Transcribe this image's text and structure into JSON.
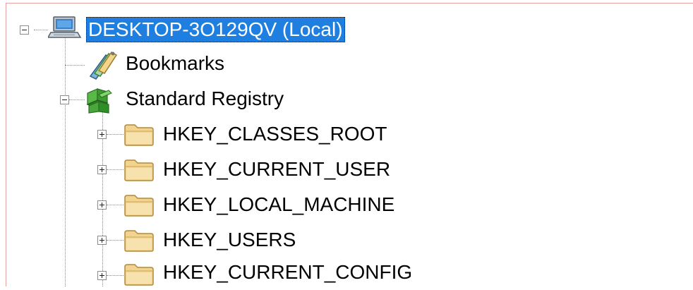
{
  "tree": {
    "root": {
      "label": "DESKTOP-3O129QV (Local)",
      "icon": "computer-icon",
      "expanded": true,
      "selected": true
    },
    "bookmarks": {
      "label": "Bookmarks",
      "icon": "bookmarks-icon"
    },
    "standard_registry": {
      "label": "Standard Registry",
      "icon": "registry-cube-icon",
      "expanded": true
    },
    "hives": [
      {
        "label": "HKEY_CLASSES_ROOT",
        "icon": "folder-icon",
        "expanded": false
      },
      {
        "label": "HKEY_CURRENT_USER",
        "icon": "folder-icon",
        "expanded": false
      },
      {
        "label": "HKEY_LOCAL_MACHINE",
        "icon": "folder-icon",
        "expanded": false
      },
      {
        "label": "HKEY_USERS",
        "icon": "folder-icon",
        "expanded": false
      },
      {
        "label": "HKEY_CURRENT_CONFIG",
        "icon": "folder-icon",
        "expanded": false
      }
    ]
  },
  "colors": {
    "selection": "#1f7fe0",
    "folder": "#f3d48f",
    "frame": "#e8a0a0"
  }
}
